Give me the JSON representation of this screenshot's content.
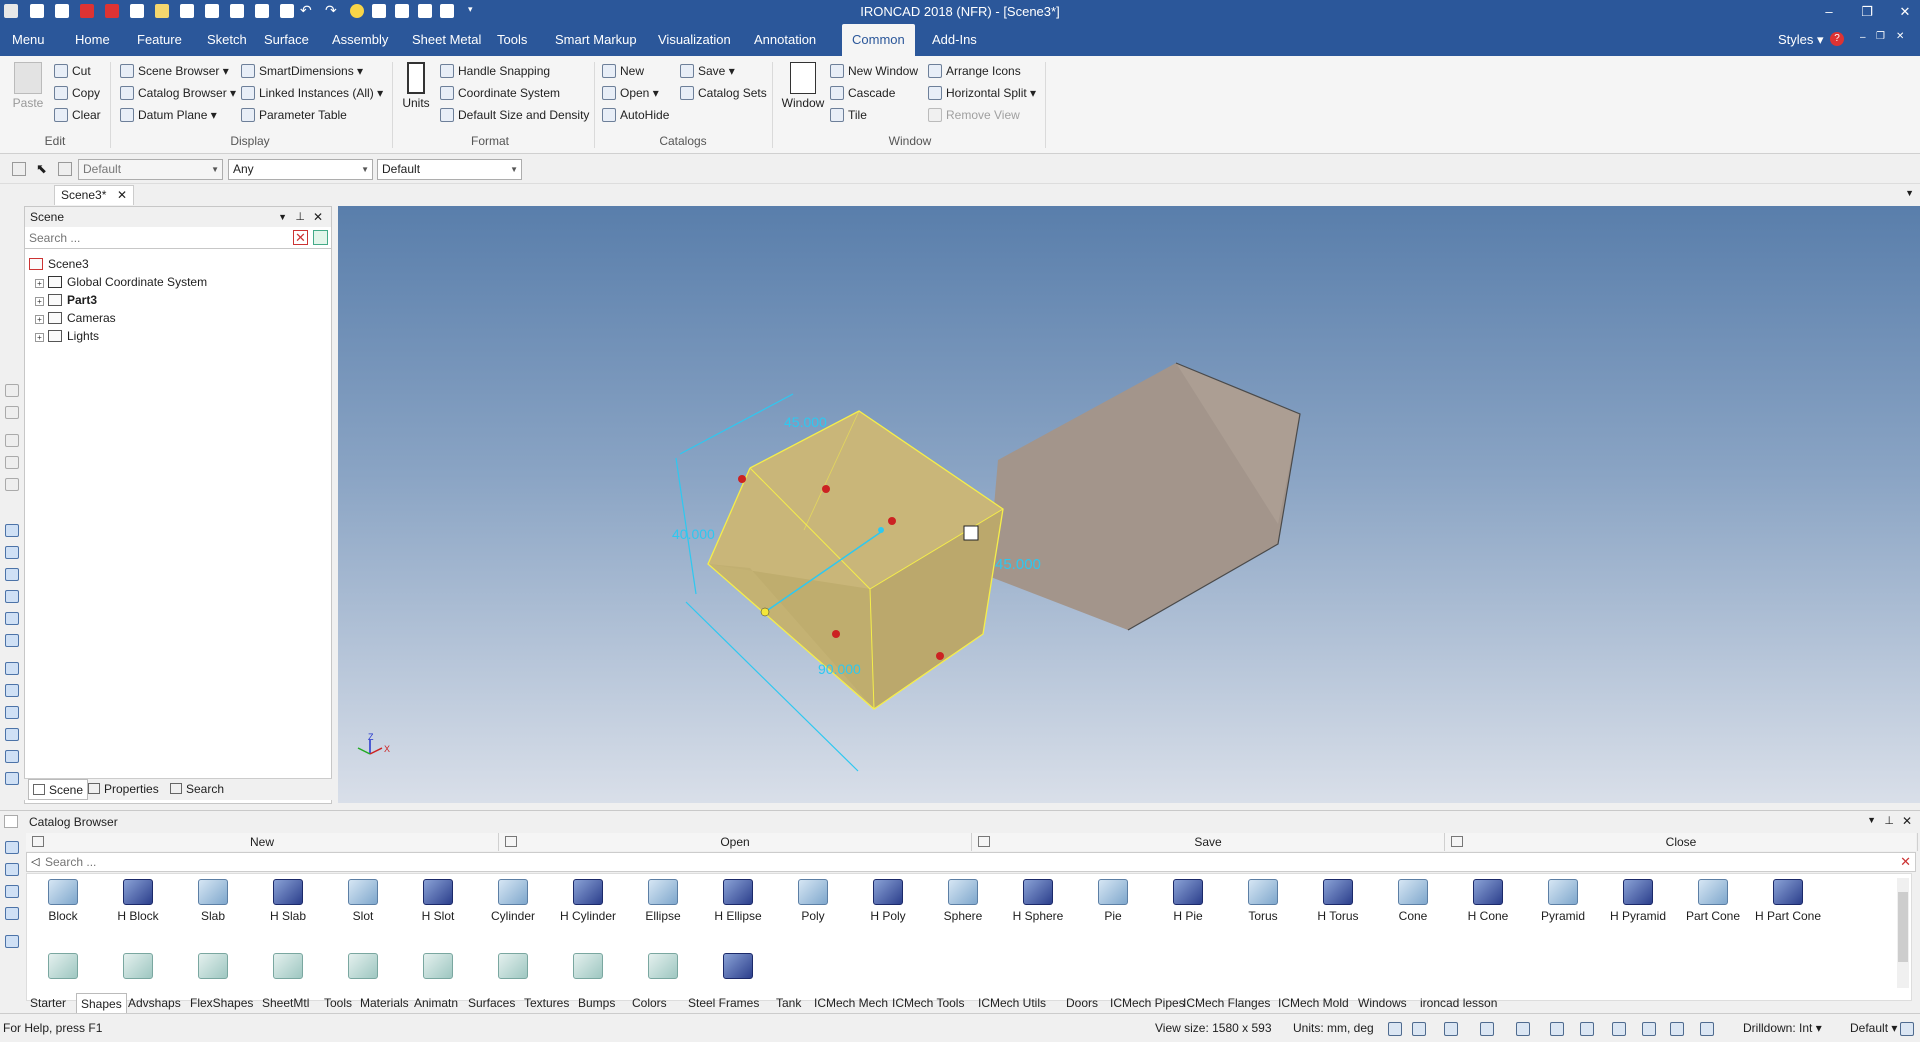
{
  "window": {
    "title": "IRONCAD 2018 (NFR) - [Scene3*]",
    "styles_label": "Styles",
    "help_label": "?"
  },
  "menu": {
    "tabs": [
      "Menu",
      "Home",
      "Feature",
      "Sketch",
      "Surface",
      "Assembly",
      "Sheet Metal",
      "Tools",
      "Smart Markup",
      "Visualization",
      "Annotation",
      "Common",
      "Add-Ins"
    ],
    "active": "Common"
  },
  "ribbon": {
    "edit": {
      "paste": "Paste",
      "cut": "Cut",
      "copy": "Copy",
      "clear": "Clear",
      "group": "Edit"
    },
    "display": {
      "scene_browser": "Scene Browser",
      "catalog_browser": "Catalog Browser",
      "datum_plane": "Datum Plane",
      "smart_dimensions": "SmartDimensions",
      "linked_instances": "Linked Instances (All)",
      "parameter_table": "Parameter Table",
      "group": "Display"
    },
    "format": {
      "units": "Units",
      "handle_snapping": "Handle Snapping",
      "coordinate_system": "Coordinate System",
      "default_size": "Default Size and Density",
      "group": "Format"
    },
    "catalogs": {
      "new": "New",
      "open": "Open",
      "autohide": "AutoHide",
      "save": "Save",
      "catalog_sets": "Catalog Sets",
      "group": "Catalogs"
    },
    "window": {
      "window": "Window",
      "new_window": "New Window",
      "cascade": "Cascade",
      "tile": "Tile",
      "arrange_icons": "Arrange Icons",
      "horizontal_split": "Horizontal Split",
      "remove_view": "Remove View",
      "group": "Window"
    }
  },
  "toolbar2": {
    "combo1": "Default",
    "combo2": "Any",
    "combo3": "Default"
  },
  "doc_tab": {
    "label": "Scene3*"
  },
  "scene_panel": {
    "title": "Scene",
    "search_placeholder": "Search ...",
    "tree": [
      {
        "label": "Scene3",
        "bold": false
      },
      {
        "label": "Global Coordinate System",
        "bold": false
      },
      {
        "label": "Part3",
        "bold": true
      },
      {
        "label": "Cameras",
        "bold": false
      },
      {
        "label": "Lights",
        "bold": false
      }
    ],
    "bottom_tabs": [
      "Scene",
      "Properties",
      "Search"
    ]
  },
  "viewport": {
    "dimensions": [
      "45.000",
      "40.000",
      "45.000",
      "90.000"
    ],
    "axis_labels": {
      "z": "Z",
      "x": "X"
    },
    "colors": {
      "selected_face": "#c9b679",
      "gray_block": "#a3958b",
      "dimension": "#2ec8f0",
      "edge": "#f5ee4a"
    }
  },
  "catalog": {
    "title": "Catalog Browser",
    "buttons": [
      "New",
      "Open",
      "Save",
      "Close"
    ],
    "search_placeholder": "Search ...",
    "items": [
      {
        "label": "Block",
        "h": false
      },
      {
        "label": "H Block",
        "h": true
      },
      {
        "label": "Slab",
        "h": false
      },
      {
        "label": "H Slab",
        "h": true
      },
      {
        "label": "Slot",
        "h": false
      },
      {
        "label": "H Slot",
        "h": true
      },
      {
        "label": "Cylinder",
        "h": false
      },
      {
        "label": "H Cylinder",
        "h": true
      },
      {
        "label": "Ellipse",
        "h": false
      },
      {
        "label": "H Ellipse",
        "h": true
      },
      {
        "label": "Poly",
        "h": false
      },
      {
        "label": "H Poly",
        "h": true
      },
      {
        "label": "Sphere",
        "h": false
      },
      {
        "label": "H Sphere",
        "h": true
      },
      {
        "label": "Pie",
        "h": false
      },
      {
        "label": "H Pie",
        "h": true
      },
      {
        "label": "Torus",
        "h": false
      },
      {
        "label": "H Torus",
        "h": true
      },
      {
        "label": "Cone",
        "h": false
      },
      {
        "label": "H Cone",
        "h": true
      },
      {
        "label": "Pyramid",
        "h": false
      },
      {
        "label": "H Pyramid",
        "h": true
      },
      {
        "label": "Part Cone",
        "h": false
      },
      {
        "label": "H Part Cone",
        "h": true
      }
    ],
    "second_row_count": 10,
    "tabs": [
      "Starter",
      "Shapes",
      "Advshaps",
      "FlexShapes",
      "SheetMtl",
      "Tools",
      "Materials",
      "Animatn",
      "Surfaces",
      "Textures",
      "Bumps",
      "Colors",
      "Steel Frames",
      "Tank",
      "ICMech Mech",
      "ICMech Tools",
      "ICMech Utils",
      "Doors",
      "ICMech Pipes",
      "ICMech Flanges",
      "ICMech Mold",
      "Windows",
      "ironcad lesson"
    ],
    "active_tab": "Shapes"
  },
  "status": {
    "help": "For Help, press F1",
    "view_size": "View size: 1580 x 593",
    "units": "Units: mm, deg",
    "drilldown": "Drilldown: Int",
    "default": "Default"
  }
}
